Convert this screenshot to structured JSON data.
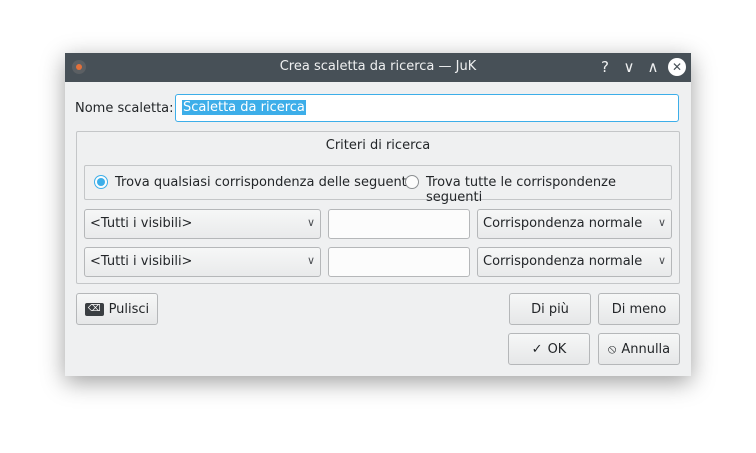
{
  "window": {
    "title": "Crea scaletta da ricerca — JuK",
    "help_icon": "?",
    "minimize_icon": "∨",
    "maximize_icon": "∧",
    "close_icon": "✕"
  },
  "name_field": {
    "label": "Nome scaletta:",
    "value": "Scaletta da ricerca"
  },
  "criteria": {
    "title": "Criteri di ricerca",
    "radio_any": "Trova qualsiasi corrispondenza delle seguenti",
    "radio_all": "Trova tutte le corrispondenze seguenti",
    "selected": "any",
    "rows": [
      {
        "column": "<Tutti i visibili>",
        "value": "",
        "mode": "Corrispondenza normale"
      },
      {
        "column": "<Tutti i visibili>",
        "value": "",
        "mode": "Corrispondenza normale"
      }
    ]
  },
  "buttons": {
    "clear": "Pulisci",
    "more": "Di più",
    "less": "Di meno",
    "ok": "OK",
    "cancel": "Annulla"
  },
  "icons": {
    "clear": "⌫",
    "ok": "✓",
    "cancel": "⦸",
    "chevron": "∨"
  },
  "colors": {
    "accent": "#3daee9",
    "titlebar": "#475057",
    "window_bg": "#eff0f1"
  }
}
